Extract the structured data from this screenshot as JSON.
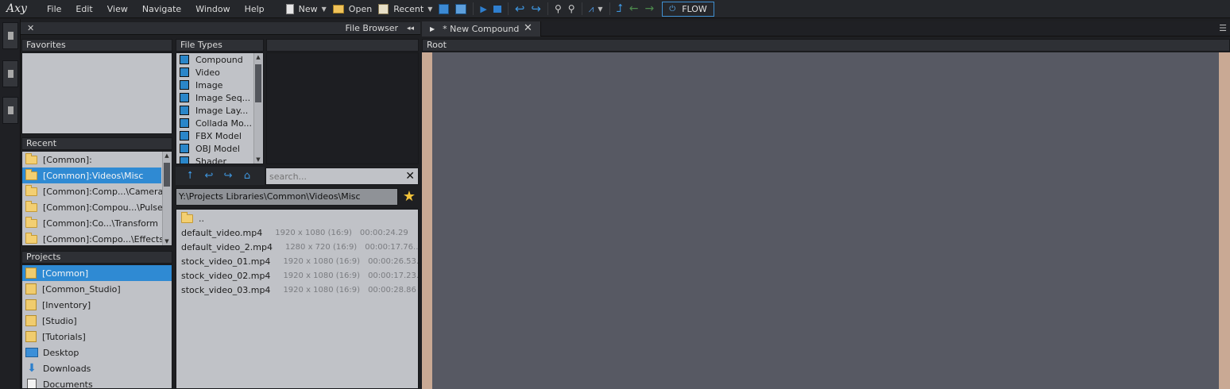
{
  "app": {
    "logo": "Axy"
  },
  "menu": [
    "File",
    "Edit",
    "View",
    "Navigate",
    "Window",
    "Help"
  ],
  "toolbar": {
    "new_label": "New",
    "open_label": "Open",
    "recent_label": "Recent",
    "flow_label": "FLOW"
  },
  "file_browser": {
    "title": "File Browser",
    "close_glyph": "✕",
    "collapse_glyph": "◂◂",
    "favorites_title": "Favorites",
    "recent_title": "Recent",
    "recent_items": [
      "[Common]:",
      "[Common]:Videos\\Misc",
      "[Common]:Comp...\\Camera",
      "[Common]:Compou...\\Pulse",
      "[Common]:Co...\\Transform",
      "[Common]:Compo...\\Effects"
    ],
    "recent_selected_index": 1,
    "projects_title": "Projects",
    "projects": [
      "[Common]",
      "[Common_Studio]",
      "[Inventory]",
      "[Studio]",
      "[Tutorials]",
      "Desktop",
      "Downloads",
      "Documents"
    ],
    "projects_selected_index": 0,
    "file_types_title": "File Types",
    "file_types": [
      "Compound",
      "Video",
      "Image",
      "Image Seq...",
      "Image Lay...",
      "Collada Mo...",
      "FBX Model",
      "OBJ Model",
      "Shader"
    ],
    "search_placeholder": "search...",
    "path": "Y:\\Projects Libraries\\Common\\Videos\\Misc",
    "files": [
      {
        "name": "..",
        "meta": "",
        "duration": ""
      },
      {
        "name": "default_video.mp4",
        "meta": "1920 x 1080 (16:9)",
        "duration": "00:00:24.29"
      },
      {
        "name": "default_video_2.mp4",
        "meta": "1280 x 720 (16:9)",
        "duration": "00:00:17.76..."
      },
      {
        "name": "stock_video_01.mp4",
        "meta": "1920 x 1080 (16:9)",
        "duration": "00:00:26.53..."
      },
      {
        "name": "stock_video_02.mp4",
        "meta": "1920 x 1080 (16:9)",
        "duration": "00:00:17.23..."
      },
      {
        "name": "stock_video_03.mp4",
        "meta": "1920 x 1080 (16:9)",
        "duration": "00:00:28.86"
      }
    ]
  },
  "editor": {
    "tab_title": "* New Compound",
    "tab_close_glyph": "✕",
    "root_label": "Root"
  },
  "colors": {
    "selection": "#2f8ad3",
    "canvas": "#575963",
    "canvas_border": "#c9a994",
    "accent": "#3e95dd"
  }
}
